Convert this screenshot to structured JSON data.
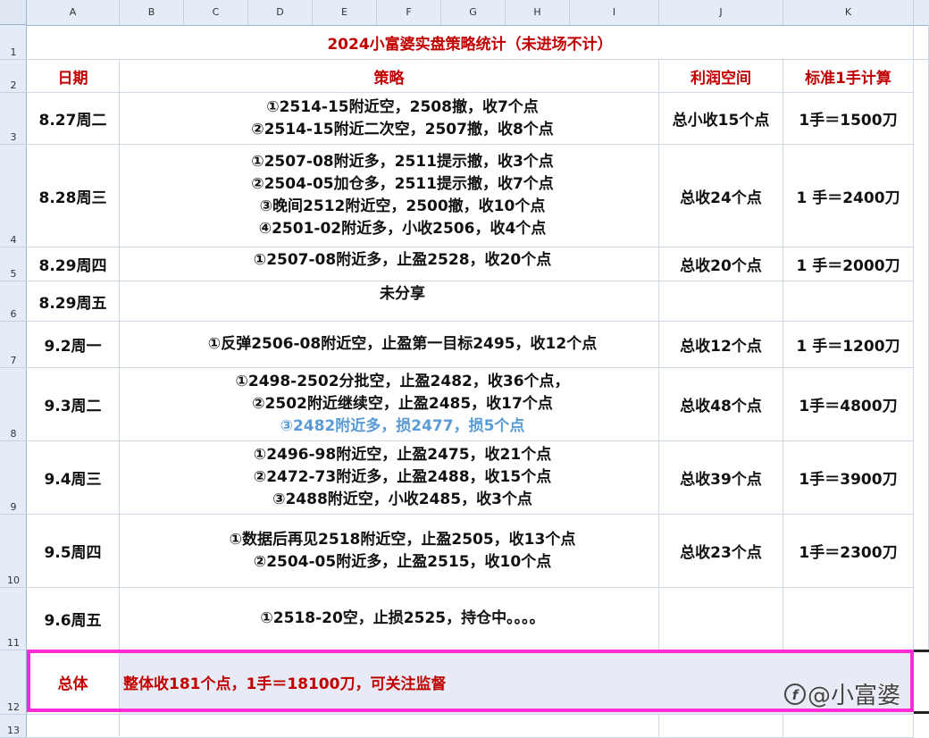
{
  "columns": [
    "A",
    "B",
    "C",
    "D",
    "E",
    "F",
    "G",
    "H",
    "I",
    "J",
    "K"
  ],
  "rows": [
    "1",
    "2",
    "3",
    "4",
    "5",
    "6",
    "7",
    "8",
    "9",
    "10",
    "11",
    "12",
    "13"
  ],
  "title": "2024小富婆实盘策略统计（未进场不计）",
  "headers": {
    "date": "日期",
    "strategy": "策略",
    "profit": "利润空间",
    "standard": "标准1手计算"
  },
  "entries": [
    {
      "date": "8.27周二",
      "lines": [
        "①2514-15附近空，2508撤，收7个点",
        "②2514-15附近二次空，2507撤，收8个点"
      ],
      "profit": "总小收15个点",
      "standard": "1手＝1500刀"
    },
    {
      "date": "8.28周三",
      "lines": [
        "①2507-08附近多，2511提示撤，收3个点",
        "②2504-05加仓多，2511提示撤，收7个点",
        "③晚间2512附近空，2500撤，收10个点",
        "④2501-02附近多，小收2506，收4个点"
      ],
      "profit": "总收24个点",
      "standard": "1 手＝2400刀"
    },
    {
      "date": "8.29周四",
      "lines": [
        "①2507-08附近多，止盈2528，收20个点"
      ],
      "profit": "总收20个点",
      "standard": "1 手＝2000刀"
    },
    {
      "date": "8.29周五",
      "lines": [
        "未分享"
      ],
      "profit": "",
      "standard": ""
    },
    {
      "date": "9.2周一",
      "lines": [
        "①反弹2506-08附近空，止盈第一目标2495，收12个点"
      ],
      "profit": "总收12个点",
      "standard": "1 手＝1200刀"
    },
    {
      "date": "9.3周二",
      "lines": [
        "①2498-2502分批空，止盈2482，收36个点，",
        "②2502附近继续空，止盈2485，收17个点",
        "③2482附近多，损2477，损5个点"
      ],
      "profit": "总收48个点",
      "standard": "1手＝4800刀"
    },
    {
      "date": "9.4周三",
      "lines": [
        "①2496-98附近空，止盈2475，收21个点",
        "②2472-73附近多，止盈2488，收15个点",
        "③2488附近空，小收2485，收3个点"
      ],
      "profit": "总收39个点",
      "standard": "1手＝3900刀"
    },
    {
      "date": "9.5周四",
      "lines": [
        "①数据后再见2518附近空，止盈2505，收13个点",
        "②2504-05附近多，止盈2515，收10个点"
      ],
      "profit": "总收23个点",
      "standard": "1手＝2300刀"
    },
    {
      "date": "9.6周五",
      "lines": [
        "①2518-20空，止损2525，持仓中。。。。"
      ],
      "profit": "",
      "standard": ""
    }
  ],
  "total": {
    "label": "总体",
    "text": "整体收181个点，1手＝18100刀，可关注监督"
  },
  "watermark": {
    "icon": "f-circle-icon",
    "glyph": "f",
    "text": "@小富婆"
  },
  "colors": {
    "header_red": "#c00000",
    "loss_blue": "#5b9bd5",
    "highlight_border": "#ff2bd6"
  }
}
